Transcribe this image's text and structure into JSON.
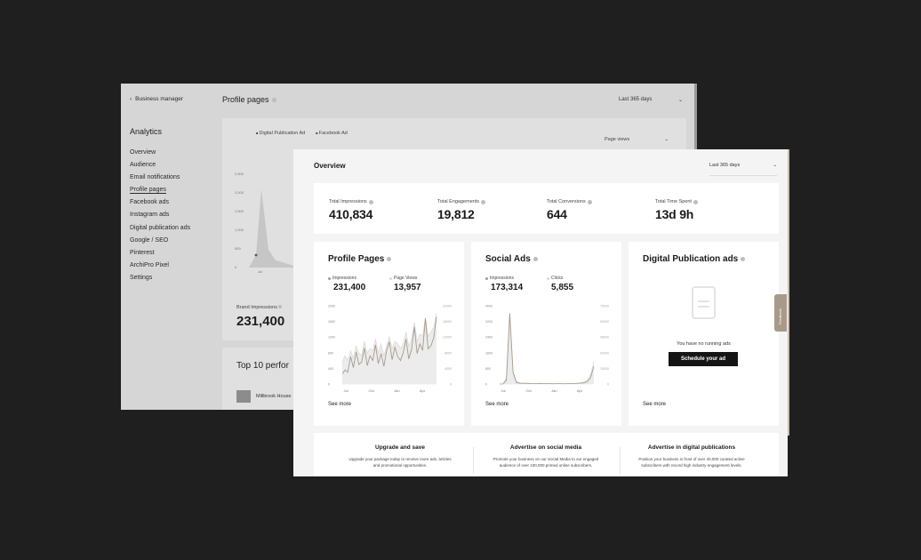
{
  "back_window": {
    "business_manager_link": "Business manager",
    "analytics_title": "Analytics",
    "nav_items": [
      "Overview",
      "Audience",
      "Email notifications",
      "Profile pages",
      "Facebook ads",
      "Instagram ads",
      "Digital publication ads",
      "Google / SEO",
      "Pinterest",
      "ArchiPro Pixel",
      "Settings"
    ],
    "active_nav": "Profile pages",
    "page_title": "Profile pages",
    "date_range": "Last 365 days",
    "legend": [
      "Digital Publication Ad",
      "Facebook Ad"
    ],
    "metric_select": "Page views",
    "y_ticks": [
      "2,500",
      "2,000",
      "1,500",
      "1,000",
      "500",
      "0"
    ],
    "x_tick": "Jul",
    "brand_impressions_label": "Brand Impressions",
    "brand_impressions_value": "231,400",
    "top10_title": "Top 10 perfor",
    "top10_row": "Millbrook House"
  },
  "front_window": {
    "title": "Overview",
    "date_range": "Last 365 days",
    "stats": [
      {
        "label": "Total Impressions",
        "value": "410,834"
      },
      {
        "label": "Total Engagements",
        "value": "19,812"
      },
      {
        "label": "Total Conversions",
        "value": "644"
      },
      {
        "label": "Total Time Spent",
        "value": "13d 9h"
      }
    ],
    "profile_pages": {
      "title": "Profile Pages",
      "metrics": [
        {
          "label": "Impressions",
          "value": "231,400"
        },
        {
          "label": "Page Views",
          "value": "13,957"
        }
      ],
      "see_more": "See more"
    },
    "social_ads": {
      "title": "Social Ads",
      "metrics": [
        {
          "label": "Impressions",
          "value": "173,314"
        },
        {
          "label": "Clicks",
          "value": "5,855"
        }
      ],
      "see_more": "See more"
    },
    "digital_publication": {
      "title": "Digital Publication ads",
      "empty_message": "You have no running ads",
      "button_label": "Schedule your ad",
      "see_more": "See more"
    },
    "promos": [
      {
        "title": "Upgrade and save",
        "description": "Upgrade your package today to receive more ads, articles and promotional opportunities."
      },
      {
        "title": "Advertise on social media",
        "description": "Promote your business on our Social Media to our engaged audience of over 100,000 primed online subscribers."
      },
      {
        "title": "Advertise in digital publications",
        "description": "Position your business in front of over 40,000 curated active subscribers with record high industry engagement levels."
      }
    ],
    "feedback_tab": "Feedback"
  },
  "colors": {
    "background": "#1f1f1f",
    "accent_line": "#a89a8a",
    "secondary_line": "#d8d8d8",
    "button": "#151515"
  },
  "chart_data": [
    {
      "type": "line",
      "title": "",
      "x_ticks": [
        "Jul",
        "Oct",
        "Jan",
        "Apr"
      ],
      "y_ticks_left": [
        "2000",
        "1600",
        "1200",
        "800",
        "400",
        "0"
      ],
      "y_ticks_right": [
        "20000",
        "16000",
        "12000",
        "8000",
        "4000",
        "0"
      ],
      "ylim": [
        0,
        2000
      ],
      "series": [
        {
          "name": "Impressions",
          "values": [
            260,
            360,
            300,
            700,
            420,
            820,
            500,
            560,
            920,
            470,
            720,
            600,
            1000,
            520,
            780,
            450,
            860,
            1080,
            620,
            940,
            700,
            600,
            800,
            1150,
            640,
            880,
            1460,
            780,
            1020,
            860,
            1680,
            900,
            980,
            1180,
            1720
          ]
        },
        {
          "name": "Page Views",
          "values": [
            900,
            1200,
            1000,
            1400,
            1100,
            1600,
            1300,
            1200,
            1800,
            1300,
            1500,
            1400,
            1900,
            1300,
            1700,
            1200,
            1600,
            2000,
            1500,
            1800,
            1700,
            1500,
            1700,
            2200,
            1600,
            1900,
            2600,
            1800,
            2100,
            2000,
            2800,
            2000,
            2200,
            2400,
            3000
          ]
        }
      ]
    },
    {
      "type": "line",
      "title": "",
      "x_ticks": [
        "Jul",
        "Oct",
        "Jan",
        "Apr"
      ],
      "y_ticks_left": [
        "4000",
        "3200",
        "2400",
        "1600",
        "800",
        "0"
      ],
      "y_ticks_right": [
        "75000",
        "60000",
        "45000",
        "30000",
        "15000",
        "0"
      ],
      "ylim": [
        0,
        4000
      ],
      "series": [
        {
          "name": "Impressions",
          "values": [
            0,
            0,
            200,
            3600,
            600,
            80,
            40,
            30,
            30,
            25,
            20,
            20,
            25,
            20,
            20,
            20,
            15,
            20,
            20,
            15,
            20,
            20,
            20,
            30,
            40,
            60,
            120,
            320,
            900
          ]
        },
        {
          "name": "Clicks",
          "values": [
            0,
            0,
            100,
            1200,
            200,
            40,
            20,
            15,
            15,
            12,
            10,
            10,
            12,
            10,
            10,
            10,
            8,
            10,
            10,
            8,
            10,
            10,
            10,
            15,
            20,
            30,
            60,
            150,
            380
          ]
        }
      ]
    }
  ]
}
